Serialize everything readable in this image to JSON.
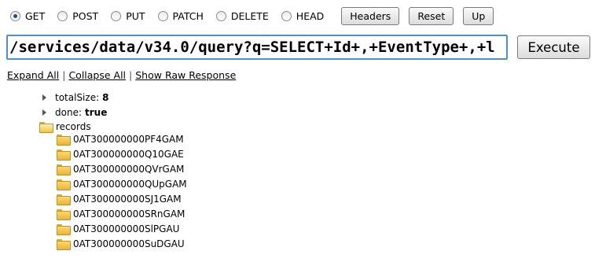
{
  "methods": [
    {
      "label": "GET",
      "checked": true
    },
    {
      "label": "POST",
      "checked": false
    },
    {
      "label": "PUT",
      "checked": false
    },
    {
      "label": "PATCH",
      "checked": false
    },
    {
      "label": "DELETE",
      "checked": false
    },
    {
      "label": "HEAD",
      "checked": false
    }
  ],
  "buttons": {
    "headers": "Headers",
    "reset": "Reset",
    "up": "Up",
    "execute": "Execute"
  },
  "query": {
    "value": "/services/data/v34.0/query?q=SELECT+Id+,+EventType+,+l"
  },
  "links": {
    "expand_all": "Expand All",
    "collapse_all": "Collapse All",
    "show_raw": "Show Raw Response",
    "separator": "|"
  },
  "tree": {
    "total_size_key": "totalSize:",
    "total_size_value": "8",
    "done_key": "done:",
    "done_value": "true",
    "records_label": "records",
    "records": [
      "0AT300000000PF4GAM",
      "0AT300000000Q10GAE",
      "0AT300000000QVrGAM",
      "0AT300000000QUpGAM",
      "0AT300000000SJ1GAM",
      "0AT300000000SRnGAM",
      "0AT300000000SlPGAU",
      "0AT300000000SuDGAU"
    ]
  }
}
